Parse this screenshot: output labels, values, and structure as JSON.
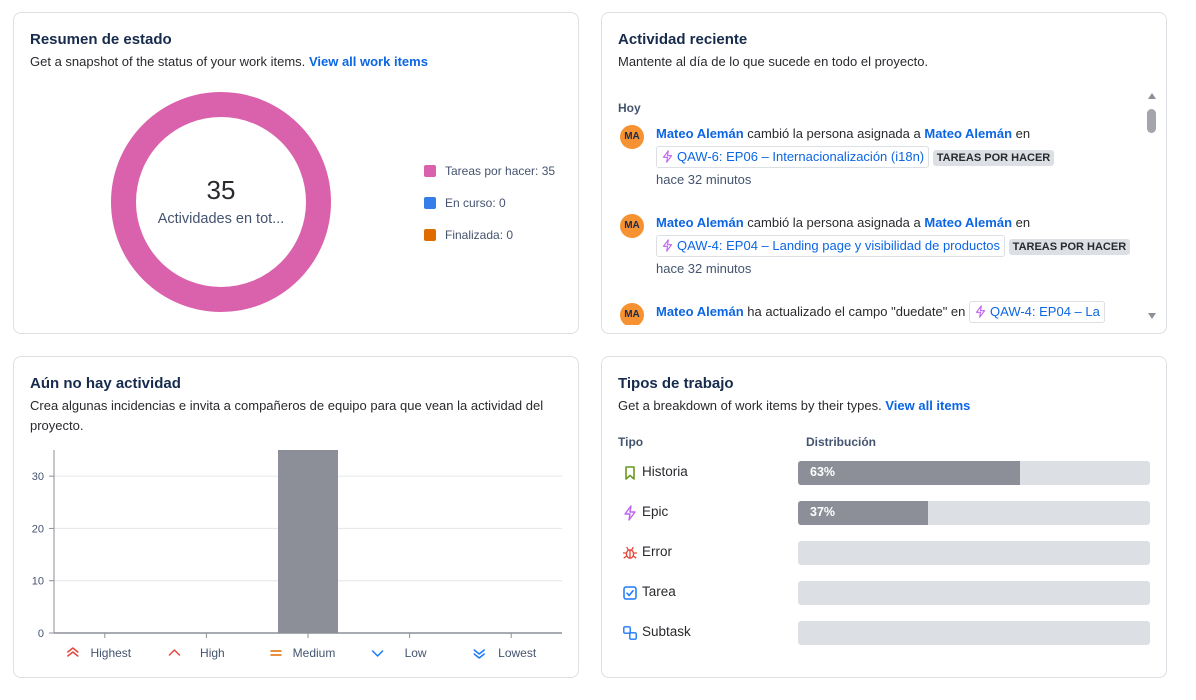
{
  "status_card": {
    "title": "Resumen de estado",
    "subtitle": "Get a snapshot of the status of your work items.",
    "link": "View all work items",
    "total": "35",
    "total_label": "Actividades en tot...",
    "legend": [
      {
        "label": "Tareas por hacer: 35",
        "color": "#da62ac",
        "value": 35
      },
      {
        "label": "En curso: 0",
        "color": "#357de8",
        "value": 0
      },
      {
        "label": "Finalizada: 0",
        "color": "#e06c00",
        "value": 0
      }
    ]
  },
  "activity_card": {
    "title": "Actividad reciente",
    "subtitle": "Mantente al día de lo que sucede en todo el proyecto.",
    "day_label": "Hoy",
    "items": [
      {
        "avatar": "MA",
        "user": "Mateo Alemán",
        "action": "cambió la persona asignada a",
        "target_user": "Mateo Alemán",
        "connector": "en",
        "issue": "QAW-6: EP06 – Internacionalización (i18n)",
        "status": "TAREAS POR HACER",
        "time": "hace 32 minutos"
      },
      {
        "avatar": "MA",
        "user": "Mateo Alemán",
        "action": "cambió la persona asignada a",
        "target_user": "Mateo Alemán",
        "connector": "en",
        "issue": "QAW-4: EP04 – Landing page y visibilidad de productos",
        "status": "TAREAS POR HACER",
        "time": "hace 32 minutos"
      },
      {
        "avatar": "MA",
        "user": "Mateo Alemán",
        "action": "ha actualizado el campo \"duedate\" en",
        "issue": "QAW-4: EP04 – La"
      }
    ]
  },
  "priority_card": {
    "title": "Aún no hay actividad",
    "subtitle": "Crea algunas incidencias e invita a compañeros de equipo para que vean la actividad del proyecto."
  },
  "chart_data": {
    "type": "bar",
    "categories": [
      "Highest",
      "High",
      "Medium",
      "Low",
      "Lowest"
    ],
    "values": [
      0,
      0,
      35,
      0,
      0
    ],
    "ylim": [
      0,
      35
    ],
    "yticks": [
      0,
      10,
      20,
      30
    ],
    "bar_color": "#8c8f97",
    "grid": true
  },
  "types_card": {
    "title": "Tipos de trabajo",
    "subtitle": "Get a breakdown of work items by their types.",
    "link": "View all items",
    "col_type": "Tipo",
    "col_dist": "Distribución",
    "rows": [
      {
        "label": "Historia",
        "icon": "bookmark-icon",
        "percent": 63,
        "pct_label": "63%"
      },
      {
        "label": "Epic",
        "icon": "lightning-icon",
        "percent": 37,
        "pct_label": "37%"
      },
      {
        "label": "Error",
        "icon": "bug-icon",
        "percent": 0,
        "pct_label": ""
      },
      {
        "label": "Tarea",
        "icon": "checkbox-icon",
        "percent": 0,
        "pct_label": ""
      },
      {
        "label": "Subtask",
        "icon": "subtask-icon",
        "percent": 0,
        "pct_label": ""
      }
    ]
  }
}
